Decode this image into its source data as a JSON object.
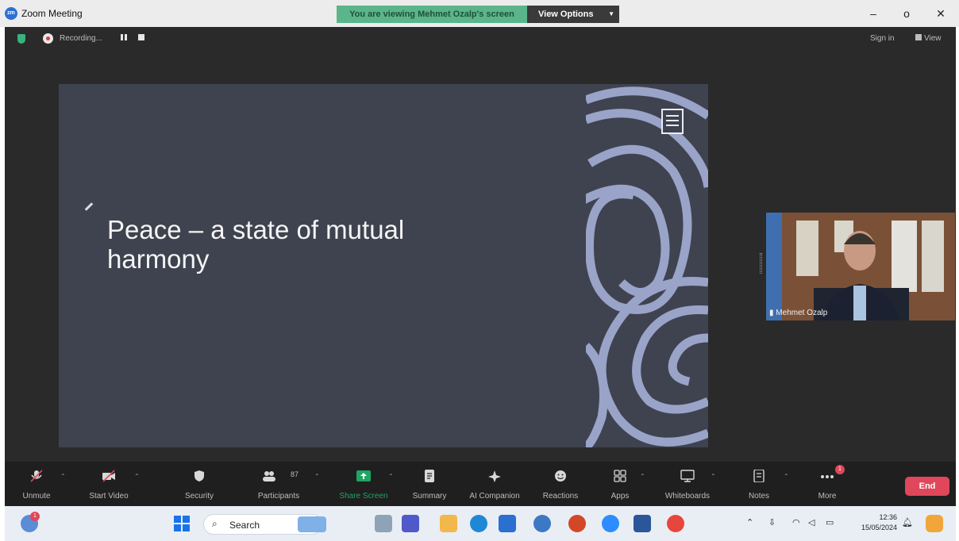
{
  "window": {
    "title": "Zoom Meeting",
    "app_icon_text": "zm",
    "viewing_banner": "You are viewing Mehmet Ozalp's screen",
    "view_options": "View Options",
    "controls": {
      "minimize": "–",
      "maximize": "o",
      "close": "✕"
    }
  },
  "meeting": {
    "recording_label": "Recording...",
    "sign_in": "Sign in",
    "view": "View"
  },
  "slide": {
    "title_line1": "Peace – a state of mutual",
    "title_line2": "harmony"
  },
  "participant": {
    "name": "Mehmet Ozalp"
  },
  "toolbar": {
    "unmute": "Unmute",
    "start_video": "Start Video",
    "security": "Security",
    "participants": "Participants",
    "participants_count": "87",
    "share_screen": "Share Screen",
    "summary": "Summary",
    "ai_companion": "AI Companion",
    "reactions": "Reactions",
    "apps": "Apps",
    "whiteboards": "Whiteboards",
    "notes": "Notes",
    "more": "More",
    "more_badge": "1",
    "end": "End"
  },
  "taskbar": {
    "search": "Search",
    "time": "12:36",
    "date": "15/05/2024",
    "weather_badge": "1"
  },
  "colors": {
    "banner": "#5bb58a",
    "end_button": "#e0475b",
    "slide_background": "#3f4350",
    "slide_pattern": "#9aa3c8"
  }
}
